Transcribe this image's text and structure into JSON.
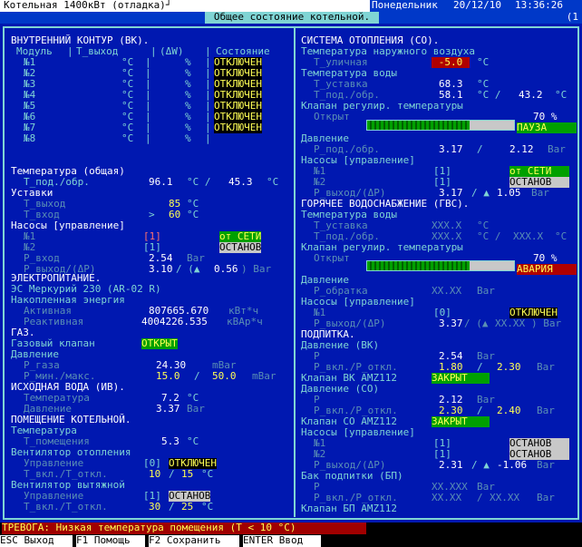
{
  "topbar": {
    "title": "Котельная 1400кВт (отладка)┘",
    "weekday": "Понедельник",
    "date": "20/12/10",
    "time": "13:36:26"
  },
  "subbar": {
    "title": "Общее состояние котельной.",
    "right": "(1"
  },
  "vk": {
    "title": "ВНУТРЕННИЙ КОНТУР (ВК).",
    "col_module": "Модуль",
    "col_tout": "T_выход",
    "col_dw": "(ΔW)",
    "col_state": "Состояние",
    "unit_c": "°C",
    "unit_pct": "%",
    "modules": [
      {
        "name": "№1",
        "state": "ОТКЛЮЧЕН"
      },
      {
        "name": "№2",
        "state": "ОТКЛЮЧЕН"
      },
      {
        "name": "№3",
        "state": "ОТКЛЮЧЕН"
      },
      {
        "name": "№4",
        "state": "ОТКЛЮЧЕН"
      },
      {
        "name": "№5",
        "state": "ОТКЛЮЧЕН"
      },
      {
        "name": "№6",
        "state": "ОТКЛЮЧЕН"
      },
      {
        "name": "№7",
        "state": "ОТКЛЮЧЕН"
      },
      {
        "name": "№8",
        "state": ""
      }
    ]
  },
  "temp_common": {
    "title": "Температура (общая)",
    "label": "T_под./обр.",
    "v1": "96.1",
    "u1": "°C /",
    "v2": "45.3",
    "u2": "°C"
  },
  "setpoints": {
    "title": "Уставки",
    "l1": "T_выход",
    "v1": "85",
    "l2": "T_вход",
    "v2": "60",
    "sep": ">",
    "unit": "°C"
  },
  "pumps_vk": {
    "title": "Насосы [управление]",
    "n1": "№1",
    "b1": "[1]",
    "s1": "от СЕТИ",
    "n2": "№2",
    "b2": "[1]",
    "s2": "ОСТАНОВ",
    "pin_label": "P_вход",
    "pin": "2.54",
    "pin_unit": "Bar",
    "pout_label": "P_выход/(ΔP)",
    "pout": "3.10",
    "pout_mid": "/ (▲",
    "pout_d": "0.56",
    "pout_unit": ") Bar"
  },
  "electric": {
    "title": "ЭЛЕКТРОПИТАНИЕ.",
    "meter": "ЭС Меркурий 230 (AR-02 R)",
    "acc": "Накопленная энергия",
    "act_label": "Активная",
    "act": "807665.670",
    "act_unit": "кВт*ч",
    "react_label": "Реактивная",
    "react": "4004226.535",
    "react_unit": "кВАр*ч"
  },
  "gas": {
    "title": "ГАЗ.",
    "valve_label": "Газовый клапан",
    "valve_state": "ОТКРЫТ",
    "press_title": "Давление",
    "pg_label": "P_газа",
    "pg": "24.30",
    "pg_unit": "mBar",
    "pmm_label": "P_мин./макс.",
    "pmin": "15.0",
    "pmm_sep": "/",
    "pmax": "50.0",
    "pmm_unit": "mBar"
  },
  "src_water": {
    "title": "ИСХОДНАЯ ВОДА (ИВ).",
    "t_label": "Температура",
    "t": "7.2",
    "t_unit": "°C",
    "p_label": "Давление",
    "p": "3.37",
    "p_unit": "Bar"
  },
  "room": {
    "title": "ПОМЕЩЕНИЕ КОТЕЛЬНОЙ.",
    "temp_title": "Температура",
    "t_label": "T_помещения",
    "t": "5.3",
    "t_unit": "°C",
    "fan1_title": "Вентилятор отопления",
    "ctrl_label": "Управление",
    "f1_b": "[0]",
    "f1_s": "ОТКЛЮЧЕН",
    "sw_label": "T_вкл./T_откл.",
    "f1_on": "10",
    "f1_sep": "/",
    "f1_off": "15",
    "f_unit": "°C",
    "fan2_title": "Вентилятор вытяжной",
    "f2_b": "[1]",
    "f2_s": "ОСТАНОВ",
    "f2_on": "30",
    "f2_off": "25"
  },
  "heating": {
    "title": "СИСТЕМА ОТОПЛЕНИЯ (СО).",
    "outdoor_title": "Температура наружного воздуха",
    "tout_label": "T_уличная",
    "tout": "-5.0",
    "unit_c": "°C",
    "water_title": "Температура воды",
    "tset_label": "T_уставка",
    "tset": "68.3",
    "tpo_label": "T_под./обр.",
    "tp": "58.1",
    "tp_u": "°C /",
    "to": "43.2",
    "valve_title": "Клапан регулир. температуры",
    "open_label": "Открыт",
    "open_pct": 70,
    "open_text": "70 %",
    "valve_state": "ПАУЗА",
    "press_title": "Давление",
    "press_label": "P_под./обр.",
    "pp": "3.17",
    "pp_sep": "/",
    "po": "2.12",
    "p_unit": "Bar",
    "pumps_title": "Насосы [управление]",
    "n1": "№1",
    "b1": "[1]",
    "s1": "от СЕТИ",
    "n2": "№2",
    "b2": "[1]",
    "s2": "ОСТАНОВ",
    "pout_label": "P_выход/(ΔP)",
    "pout": "3.17",
    "pout_mid": "/ ▲",
    "pout_d": "1.05",
    "pout_unit": "Bar"
  },
  "gvs": {
    "title": "ГОРЯЧЕЕ ВОДОСНАБЖЕНИЕ (ГВС).",
    "water_title": "Температура воды",
    "tset_label": "T_уставка",
    "tset": "XXX.X",
    "unit_c": "°C",
    "tpo_label": "T_под./обр.",
    "tp": "XXX.X",
    "tp_u": "°C /",
    "to": "XXX.X",
    "valve_title": "Клапан регулир. температуры",
    "open_label": "Открыт",
    "open_pct": 70,
    "open_text": "70 %",
    "valve_state": "АВАРИЯ",
    "press_title": "Давление",
    "pr_label": "P_обратка",
    "pr": "XX.XX",
    "p_unit": "Bar",
    "pumps_title": "Насосы [управление]",
    "n1": "№1",
    "b1": "[0]",
    "s1": "ОТКЛЮЧЕН",
    "pout_label": "P_выход/(ΔP)",
    "pout": "3.37",
    "pout_mid": "/ (▲",
    "pout_d": "XX.XX",
    "pout_unit": ") Bar"
  },
  "makeup": {
    "title": "ПОДПИТКА.",
    "vk_title": "Давление (ВК)",
    "p_label": "P",
    "vk_p": "2.54",
    "p_unit": "Bar",
    "sw_label": "P_вкл./P_откл.",
    "vk_on": "1.80",
    "sep": "/",
    "vk_off": "2.30",
    "vk_valve_label": "Клапан ВК AMZ112",
    "vk_valve": "ЗАКРЫТ",
    "co_title": "Давление (СО)",
    "co_p": "2.12",
    "co_on": "2.30",
    "co_off": "2.40",
    "co_valve_label": "Клапан СО AMZ112",
    "co_valve": "ЗАКРЫТ",
    "pumps_title": "Насосы [управление]",
    "n1": "№1",
    "b1": "[1]",
    "s1": "ОСТАНОВ",
    "n2": "№2",
    "b2": "[1]",
    "s2": "ОСТАНОВ",
    "pout_label": "P_выход/(ΔP)",
    "pout": "2.31",
    "pout_mid": "/ ▲",
    "pout_d": "-1.06",
    "pout_unit": "Bar",
    "tank_title": "Бак подпитки (БП)",
    "tank_p": "XX.XXX",
    "tank_on": "XX.XX",
    "tank_off": "XX.XX",
    "tank_valve_label": "Клапан БП AMZ112"
  },
  "alarm": {
    "text": "ТРЕВОГА: Низкая температура помещения (T <  10 °C)"
  },
  "footer": {
    "k1": "ESC",
    "l1": "Выход",
    "k2": "F1",
    "l2": "Помощь",
    "k3": "F2",
    "l3": "Сохранить",
    "k4": "ENTER",
    "l4": "Ввод"
  },
  "colors": {
    "bg": "#0018b0",
    "accent": "#7fd4d4",
    "value": "#ffffff",
    "warn": "#ffff55",
    "alarm": "#a00000",
    "ok": "#00a000"
  }
}
